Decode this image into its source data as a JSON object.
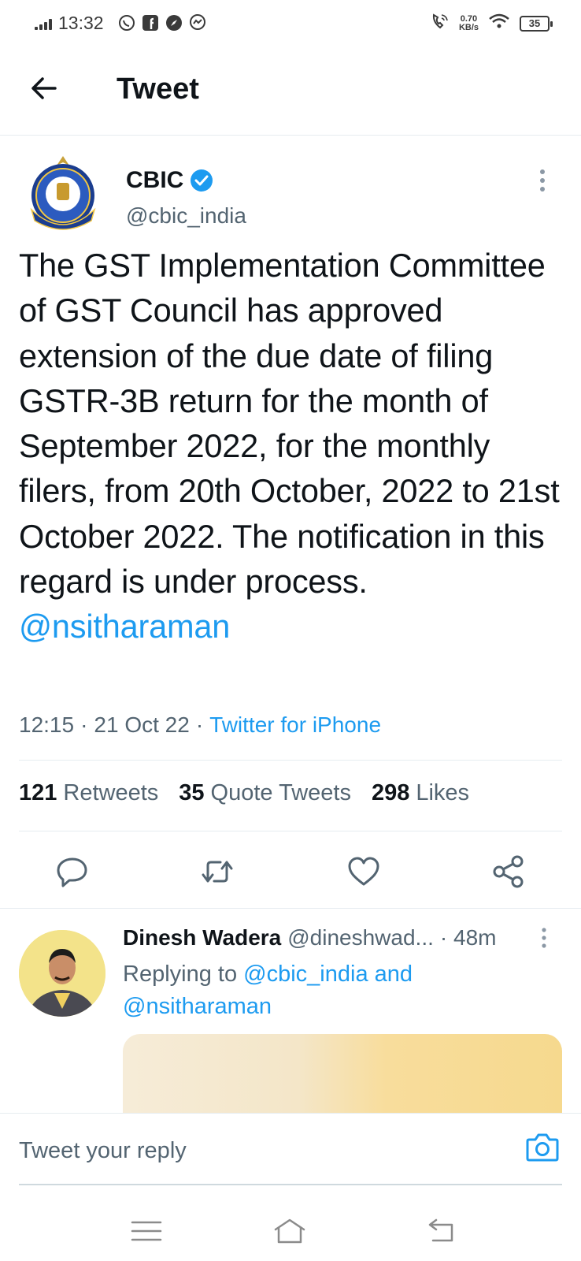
{
  "status_bar": {
    "time": "13:32",
    "speed_value": "0.70",
    "speed_unit": "KB/s",
    "battery": "35",
    "icons": [
      "signal-icon",
      "whatsapp-icon",
      "facebook-icon",
      "compass-icon",
      "messenger-icon",
      "call-icon",
      "wifi-icon",
      "battery-icon"
    ]
  },
  "header": {
    "title": "Tweet"
  },
  "tweet": {
    "author_name": "CBIC",
    "author_handle": "@cbic_india",
    "text": "The GST Implementation Committee of GST Council has approved extension of the due date of filing GSTR-3B return for the month of September 2022, for the monthly filers, from 20th October, 2022 to 21st October 2022. The notification in this regard is under process.",
    "mention": "@nsitharaman",
    "time": "12:15",
    "date": "21 Oct 22",
    "separator": "·",
    "client": "Twitter for iPhone",
    "stats": {
      "retweets_count": "121",
      "retweets_label": "Retweets",
      "quotes_count": "35",
      "quotes_label": "Quote Tweets",
      "likes_count": "298",
      "likes_label": "Likes"
    }
  },
  "reply": {
    "author_name": "Dinesh Wadera",
    "author_handle": "@dineshwad...",
    "time": "· 48m",
    "replying_prefix": "Replying to",
    "replying_to_1": "@cbic_india",
    "replying_and": "and",
    "replying_to_2": "@nsitharaman"
  },
  "composer": {
    "placeholder": "Tweet your reply"
  },
  "colors": {
    "accent": "#1d9bf0",
    "text": "#0f1419",
    "secondary": "#536471",
    "border": "#e6ecf0"
  }
}
